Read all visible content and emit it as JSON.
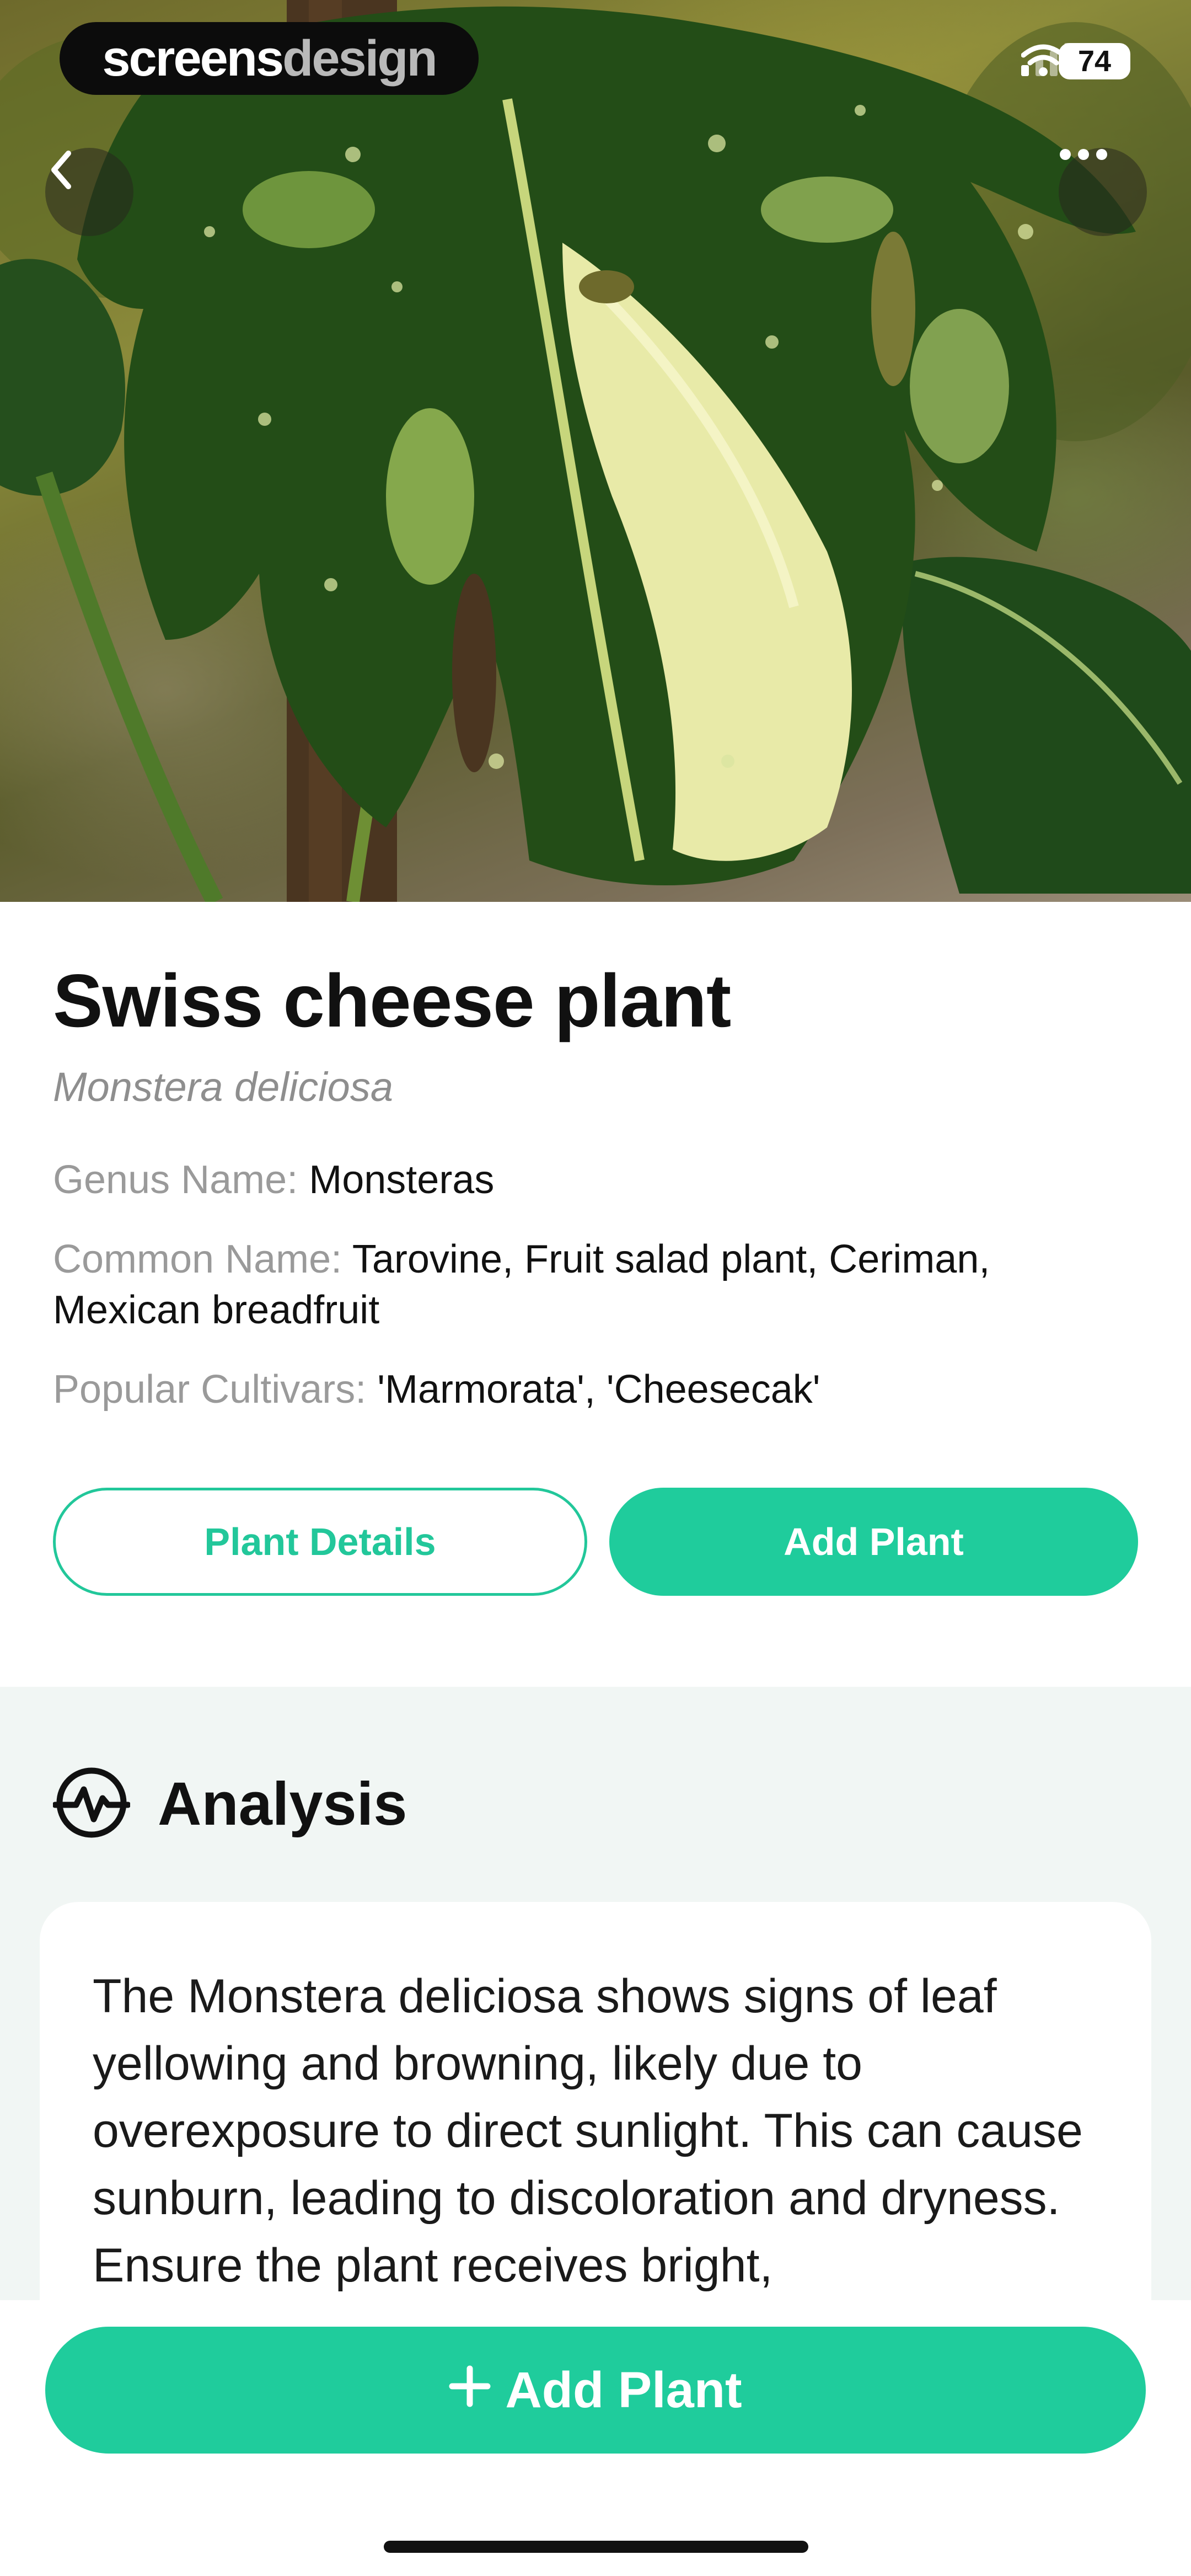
{
  "watermark": {
    "part1": "screens",
    "part2": "design"
  },
  "status_bar": {
    "battery": "74"
  },
  "nav": {
    "back_icon": "chevron-left-icon",
    "more_icon": "more-icon"
  },
  "plant": {
    "name": "Swiss cheese plant",
    "scientific_name": "Monstera deliciosa",
    "genus_label": "Genus Name:",
    "genus_value": "Monsteras",
    "common_label": "Common Name:",
    "common_value": "Tarovine, Fruit salad plant, Ceriman, Mexican breadfruit",
    "cultivars_label": "Popular Cultivars:",
    "cultivars_value": "'Marmorata',  'Cheesecak'"
  },
  "actions": {
    "details_label": "Plant Details",
    "add_label": "Add Plant"
  },
  "analysis": {
    "title": "Analysis",
    "text": "The Monstera deliciosa shows signs of leaf yellowing and browning, likely due to overexposure to direct sunlight. This can cause sunburn, leading to discoloration and dryness. Ensure the plant receives bright,"
  },
  "bottom_cta": {
    "label": "Add Plant",
    "icon": "plus-icon"
  },
  "colors": {
    "accent": "#1fcc9c",
    "analysis_bg": "#f1f6f4",
    "muted": "#9a9a9a"
  }
}
